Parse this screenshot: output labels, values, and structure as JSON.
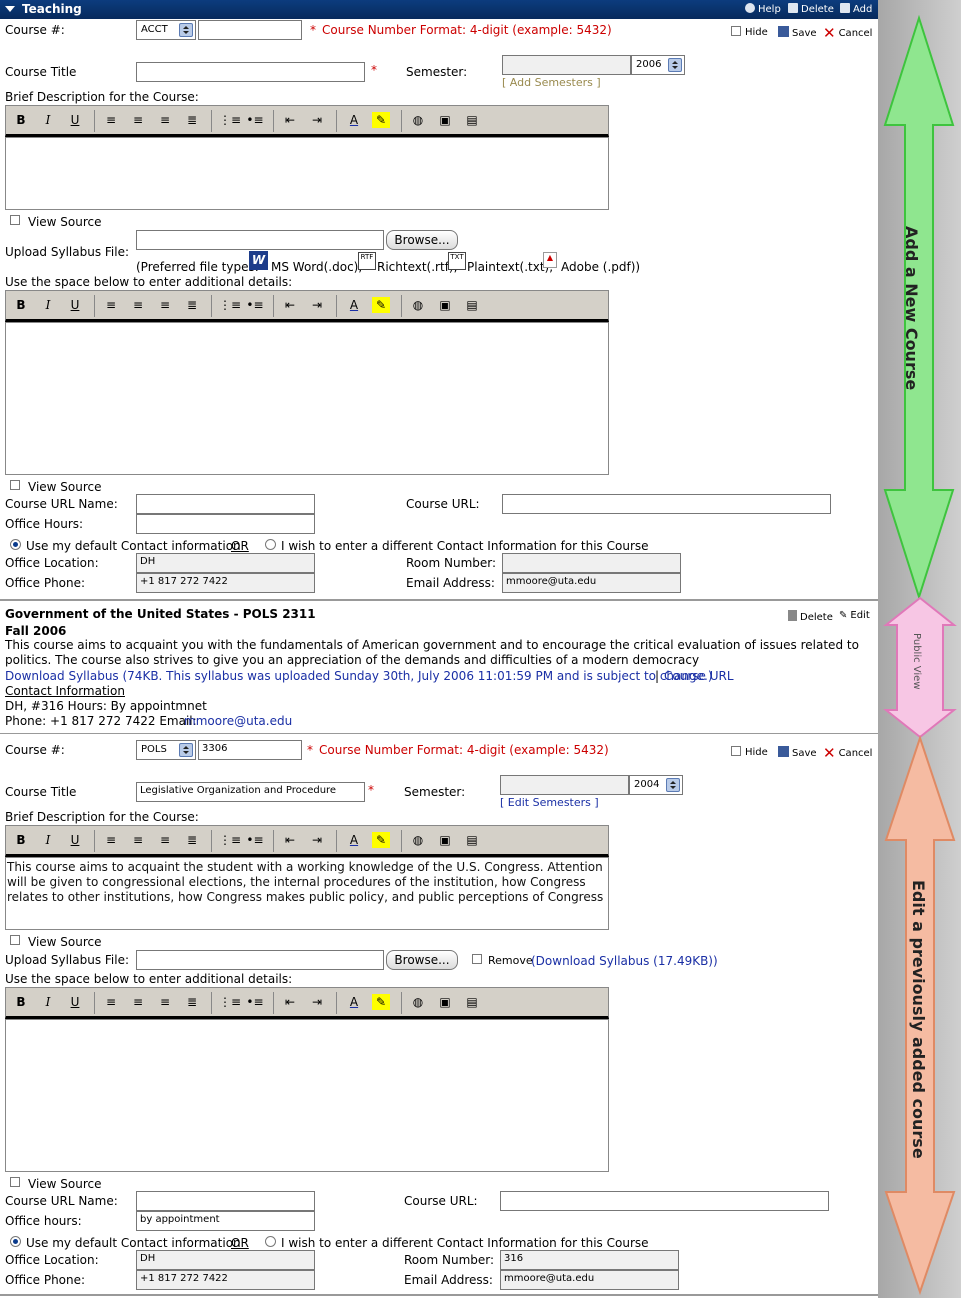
{
  "header": {
    "title": "Teaching",
    "help": "Help",
    "delete": "Delete",
    "add": "Add"
  },
  "row_actions": {
    "hide": "Hide",
    "save": "Save",
    "cancel": "Cancel"
  },
  "new_course": {
    "course_num_label": "Course #:",
    "dept": "ACCT",
    "number": "",
    "format_note": "Course Number Format: 4-digit (example: 5432)",
    "required_mark": "*",
    "title_label": "Course Title",
    "title_value": "",
    "semester_label": "Semester:",
    "semester_value": "",
    "year": "2006",
    "semesters_link": "[ Add Semesters ]",
    "desc_label": "Brief Description for the Course:",
    "desc_text": "",
    "view_source": "View Source",
    "upload_label": "Upload Syllabus File:",
    "browse": "Browse...",
    "preferred": "(Preferred file types:",
    "ft_word": "MS Word(.doc),",
    "ft_rtf": "Richtext(.rtf),",
    "ft_txt": "Plaintext(.txt),",
    "ft_pdf": "Adobe (.pdf))",
    "details_label": "Use the space below to enter additional details:",
    "details_text": "",
    "view_source2": "View Source",
    "url_name_label": "Course URL Name:",
    "url_label": "Course URL:",
    "url_name": "",
    "url": "",
    "hours_label": "Office Hours:",
    "hours": "",
    "contact_default": "Use my default Contact information",
    "or": "OR",
    "contact_other": "I wish to enter a different Contact Information for this Course",
    "location_label": "Office Location:",
    "location": "DH",
    "room_label": "Room Number:",
    "room": "",
    "phone_label": "Office Phone:",
    "phone": "+1 817 272 7422",
    "email_label": "Email Address:",
    "email": "mmoore@uta.edu"
  },
  "public": {
    "title": "Government of the United States - POLS 2311",
    "term": "Fall 2006",
    "delete": "Delete",
    "edit": "Edit",
    "desc": "This course aims to acquaint you with the fundamentals of American government and to encourage the critical evaluation of issues related to politics. The course also strives to give you an appreciation of the demands and difficulties of a modern democracy",
    "download": "Download Syllabus (74KB. This syllabus was uploaded Sunday 30th, July 2006 11:01:59 PM and is subject to change.)",
    "sep": "|",
    "course_url": "Course URL",
    "contact_heading": "Contact Information",
    "location_hours": "DH, #316  Hours: By appointmnet",
    "phone_email": "Phone: +1 817 272 7422  Email:",
    "email": "mmoore@uta.edu"
  },
  "edit_course": {
    "course_num_label": "Course #:",
    "dept": "POLS",
    "number": "3306",
    "format_note": "Course Number Format: 4-digit (example: 5432)",
    "required_mark": "*",
    "title_label": "Course Title",
    "title_value": "Legislative Organization and Procedure",
    "semester_label": "Semester:",
    "year": "2004",
    "semesters_link": "[ Edit Semesters ]",
    "desc_label": "Brief Description for the Course:",
    "desc_text": "This course aims to acquaint the student with a working knowledge of the U.S. Congress. Attention will be given to congressional elections, the internal procedures of the institution, how Congress relates to other institutions, how Congress makes public policy, and public perceptions of Congress",
    "view_source": "View Source",
    "upload_label": "Upload Syllabus File:",
    "browse": "Browse...",
    "remove": "Remove",
    "download": "(Download Syllabus (17.49KB))",
    "details_label": "Use the space below to enter additional details:",
    "view_source2": "View Source",
    "url_name_label": "Course URL Name:",
    "url_label": "Course URL:",
    "hours_label": "Office hours:",
    "hours": "by appointment",
    "contact_default": "Use my default Contact information",
    "or": "OR",
    "contact_other": "I wish to enter a different Contact Information for this Course",
    "location_label": "Office Location:",
    "location": "DH",
    "room_label": "Room Number:",
    "room": "316",
    "phone_label": "Office Phone:",
    "phone": "+1 817 272 7422",
    "email_label": "Email Address:",
    "email": "mmoore@uta.edu"
  },
  "annotations": {
    "add": "Add a New Course",
    "public": "Public View",
    "edit": "Edit a previously added course"
  },
  "toolbar_icons": [
    "bold-icon",
    "italic-icon",
    "underline-icon",
    "align-left-icon",
    "align-center-icon",
    "align-right-icon",
    "justify-icon",
    "numbered-list-icon",
    "bullet-list-icon",
    "outdent-icon",
    "indent-icon",
    "font-color-icon",
    "highlight-icon",
    "link-icon",
    "image-icon",
    "table-icon"
  ],
  "colors": {
    "header": "#0c3c7e",
    "required": "#cc0000",
    "link": "#1a2fa5",
    "add_arrow": "#7fe07f",
    "public_arrow": "#f2b3d8",
    "edit_arrow": "#f2b096"
  }
}
